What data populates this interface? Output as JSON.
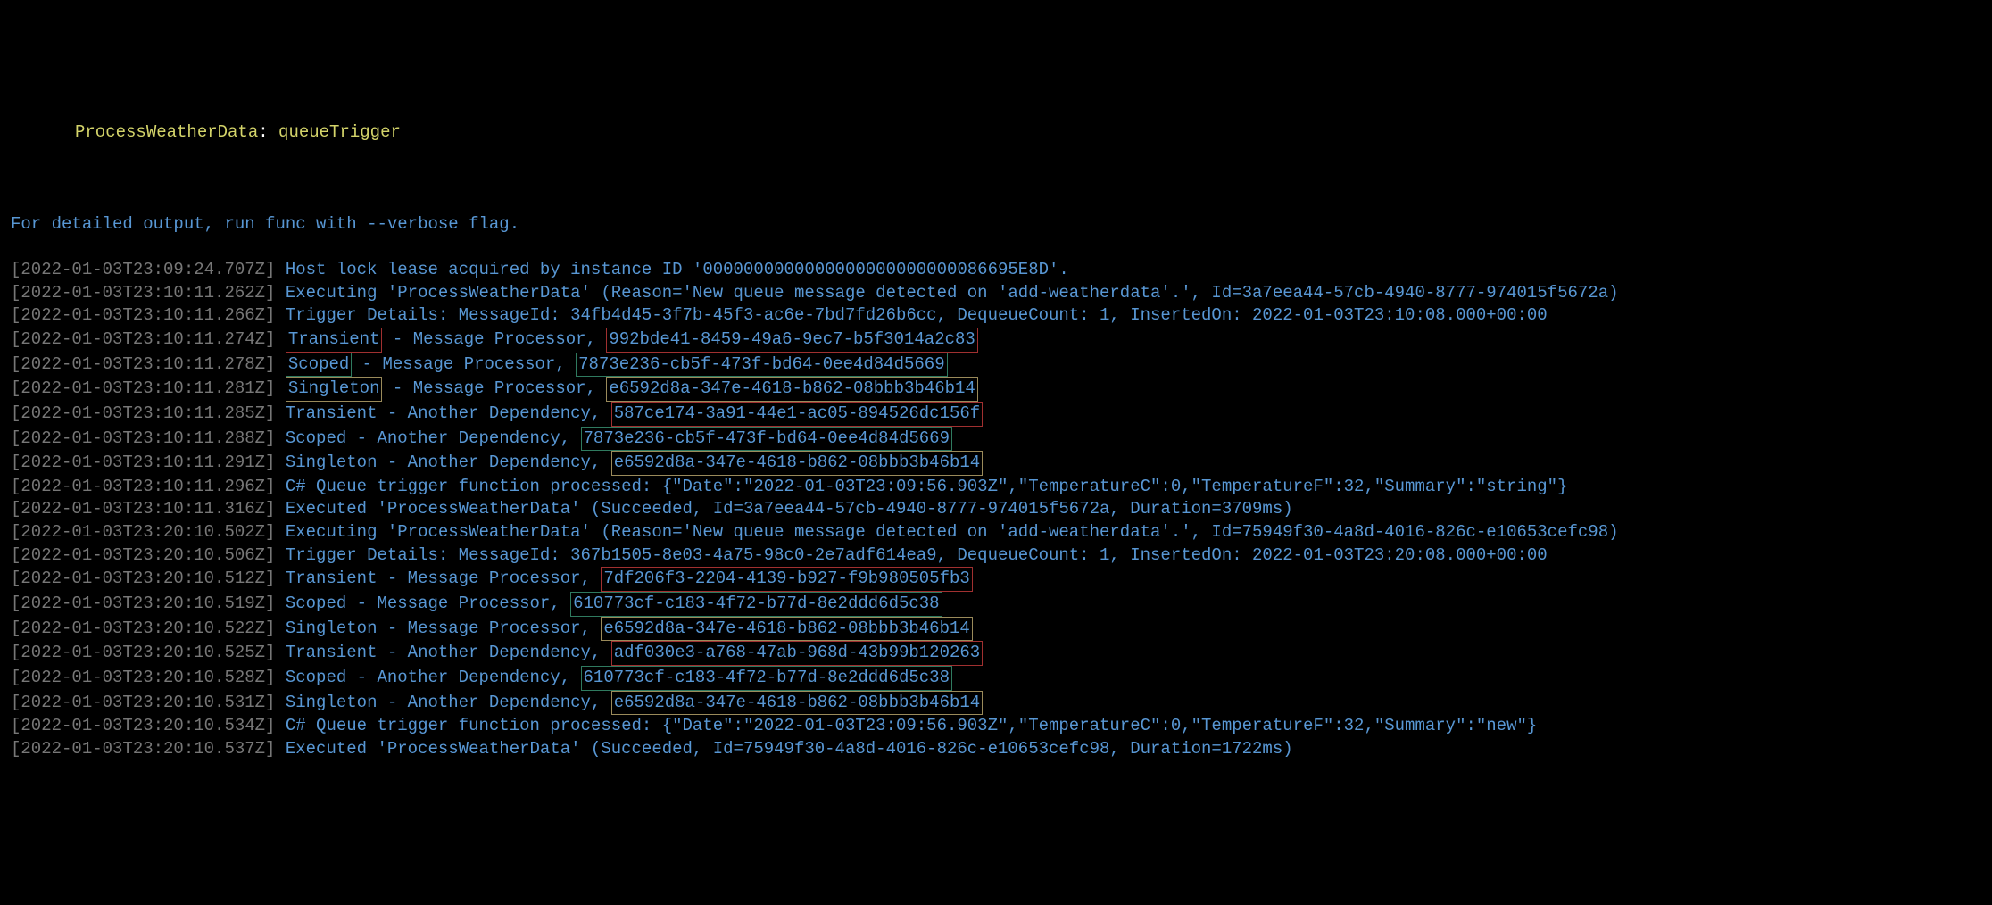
{
  "header": {
    "func_name": "ProcessWeatherData",
    "sep": ": ",
    "binding": "queueTrigger"
  },
  "verbose_msg": "For detailed output, run func with --verbose flag.",
  "lines": [
    {
      "ts": "[2022-01-03T23:09:24.707Z]",
      "msg": " Host lock lease acquired by instance ID '0000000000000000000000000086695E8D'."
    },
    {
      "ts": "[2022-01-03T23:10:11.262Z]",
      "msg": " Executing 'ProcessWeatherData' (Reason='New queue message detected on 'add-weatherdata'.', Id=3a7eea44-57cb-4940-8777-974015f5672a)"
    },
    {
      "ts": "[2022-01-03T23:10:11.266Z]",
      "msg": " Trigger Details: MessageId: 34fb4d45-3f7b-45f3-ac6e-7bd7fd26b6cc, DequeueCount: 1, InsertedOn: 2022-01-03T23:10:08.000+00:00"
    },
    {
      "ts": "[2022-01-03T23:10:11.274Z]",
      "box_label": "Transient",
      "box_label_cls": "box-red",
      "mid": " - Message Processor, ",
      "box_guid": "992bde41-8459-49a6-9ec7-b5f3014a2c83",
      "box_guid_cls": "box-red"
    },
    {
      "ts": "[2022-01-03T23:10:11.278Z]",
      "box_label": "Scoped",
      "box_label_cls": "box-green",
      "mid": " - Message Processor, ",
      "box_guid": "7873e236-cb5f-473f-bd64-0ee4d84d5669",
      "box_guid_cls": "box-green"
    },
    {
      "ts": "[2022-01-03T23:10:11.281Z]",
      "box_label": "Singleton",
      "box_label_cls": "box-tan",
      "mid": " - Message Processor, ",
      "box_guid": "e6592d8a-347e-4618-b862-08bbb3b46b14",
      "box_guid_cls": "box-tan"
    },
    {
      "ts": "[2022-01-03T23:10:11.285Z]",
      "plain": " Transient - Another Dependency, ",
      "box_guid": "587ce174-3a91-44e1-ac05-894526dc156f",
      "box_guid_cls": "box-red"
    },
    {
      "ts": "[2022-01-03T23:10:11.288Z]",
      "plain": " Scoped - Another Dependency, ",
      "box_guid": "7873e236-cb5f-473f-bd64-0ee4d84d5669",
      "box_guid_cls": "box-green"
    },
    {
      "ts": "[2022-01-03T23:10:11.291Z]",
      "plain": " Singleton - Another Dependency, ",
      "box_guid": "e6592d8a-347e-4618-b862-08bbb3b46b14",
      "box_guid_cls": "box-tan"
    },
    {
      "ts": "[2022-01-03T23:10:11.296Z]",
      "msg": " C# Queue trigger function processed: {\"Date\":\"2022-01-03T23:09:56.903Z\",\"TemperatureC\":0,\"TemperatureF\":32,\"Summary\":\"string\"}"
    },
    {
      "ts": "[2022-01-03T23:10:11.316Z]",
      "msg": " Executed 'ProcessWeatherData' (Succeeded, Id=3a7eea44-57cb-4940-8777-974015f5672a, Duration=3709ms)"
    },
    {
      "ts": "[2022-01-03T23:20:10.502Z]",
      "msg": " Executing 'ProcessWeatherData' (Reason='New queue message detected on 'add-weatherdata'.', Id=75949f30-4a8d-4016-826c-e10653cefc98)"
    },
    {
      "ts": "[2022-01-03T23:20:10.506Z]",
      "msg": " Trigger Details: MessageId: 367b1505-8e03-4a75-98c0-2e7adf614ea9, DequeueCount: 1, InsertedOn: 2022-01-03T23:20:08.000+00:00"
    },
    {
      "ts": "[2022-01-03T23:20:10.512Z]",
      "plain": " Transient - Message Processor, ",
      "box_guid": "7df206f3-2204-4139-b927-f9b980505fb3",
      "box_guid_cls": "box-red"
    },
    {
      "ts": "[2022-01-03T23:20:10.519Z]",
      "plain": " Scoped - Message Processor, ",
      "box_guid": "610773cf-c183-4f72-b77d-8e2ddd6d5c38",
      "box_guid_cls": "box-green"
    },
    {
      "ts": "[2022-01-03T23:20:10.522Z]",
      "plain": " Singleton - Message Processor, ",
      "box_guid": "e6592d8a-347e-4618-b862-08bbb3b46b14",
      "box_guid_cls": "box-tan"
    },
    {
      "ts": "[2022-01-03T23:20:10.525Z]",
      "plain": " Transient - Another Dependency, ",
      "box_guid": "adf030e3-a768-47ab-968d-43b99b120263",
      "box_guid_cls": "box-red"
    },
    {
      "ts": "[2022-01-03T23:20:10.528Z]",
      "plain": " Scoped - Another Dependency, ",
      "box_guid": "610773cf-c183-4f72-b77d-8e2ddd6d5c38",
      "box_guid_cls": "box-green"
    },
    {
      "ts": "[2022-01-03T23:20:10.531Z]",
      "plain": " Singleton - Another Dependency, ",
      "box_guid": "e6592d8a-347e-4618-b862-08bbb3b46b14",
      "box_guid_cls": "box-tan"
    },
    {
      "ts": "[2022-01-03T23:20:10.534Z]",
      "msg": " C# Queue trigger function processed: {\"Date\":\"2022-01-03T23:09:56.903Z\",\"TemperatureC\":0,\"TemperatureF\":32,\"Summary\":\"new\"}"
    },
    {
      "ts": "[2022-01-03T23:20:10.537Z]",
      "msg": " Executed 'ProcessWeatherData' (Succeeded, Id=75949f30-4a8d-4016-826c-e10653cefc98, Duration=1722ms)"
    }
  ]
}
